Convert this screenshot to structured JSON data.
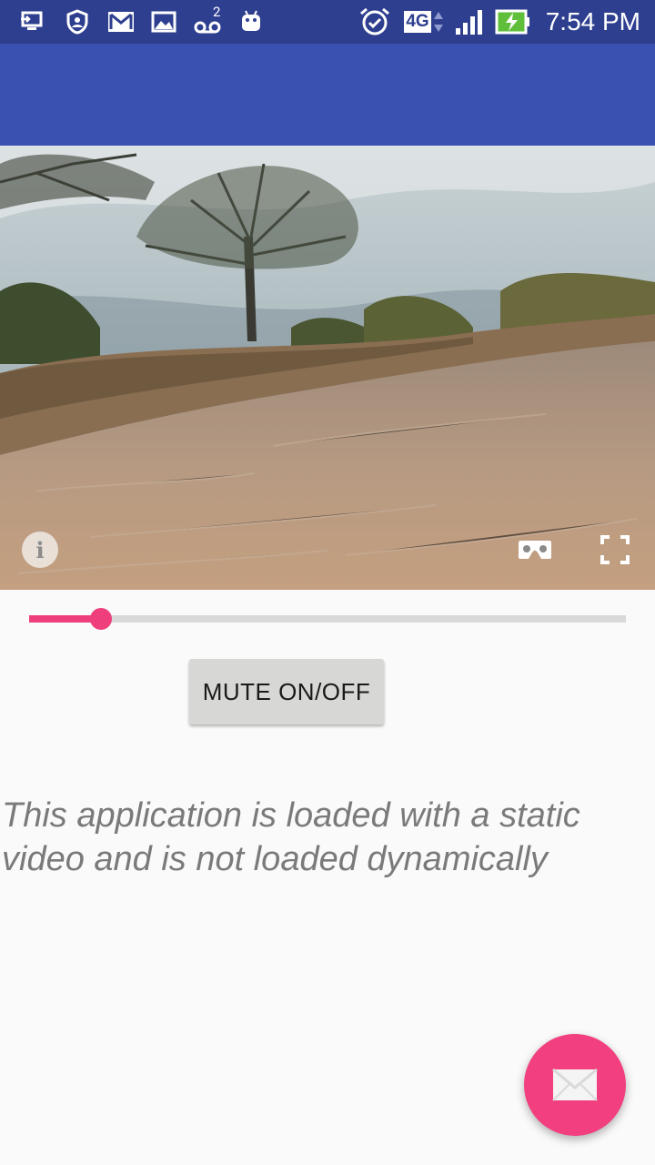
{
  "status_bar": {
    "time": "7:54 PM",
    "network_label": "4G",
    "voicemail_count": "2",
    "icons": [
      "screen-cast-icon",
      "shield-user-icon",
      "gmail-icon",
      "gallery-icon",
      "voicemail-icon",
      "android-icon",
      "alarm-icon",
      "network-4g-icon",
      "signal-icon",
      "battery-charging-icon"
    ]
  },
  "app_bar": {
    "color": "#3b51b1"
  },
  "video": {
    "info_label": "i",
    "controls": [
      "info-icon",
      "cardboard-vr-icon",
      "fullscreen-icon"
    ]
  },
  "slider": {
    "value_fraction": 0.12,
    "accent": "#ee3f7c"
  },
  "mute_button": {
    "label": "MUTE ON/OFF"
  },
  "note": {
    "text": "This application is loaded with a static video and is not loaded dynamically"
  },
  "fab": {
    "icon": "mail-icon",
    "color": "#f23f7f"
  }
}
